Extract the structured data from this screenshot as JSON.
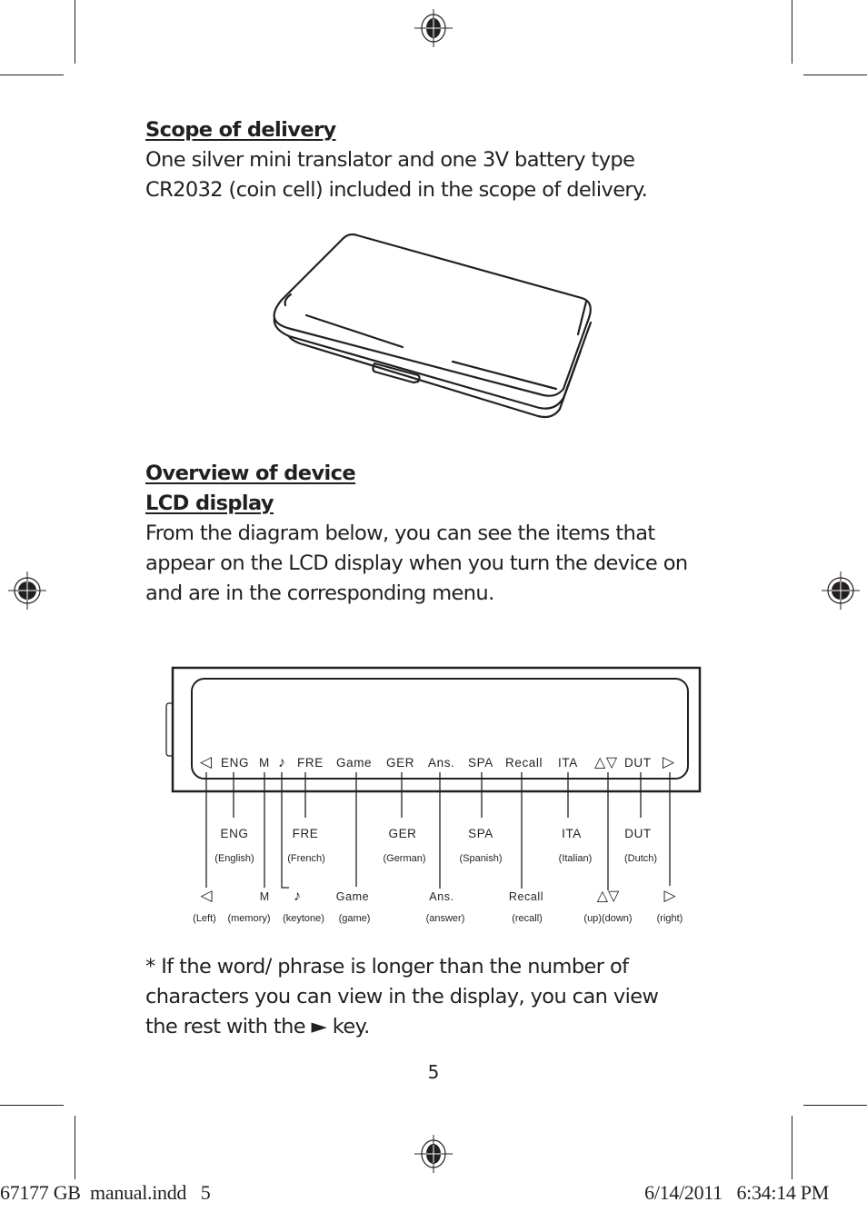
{
  "page": {
    "page_number": "5",
    "slug_left": "67177 GB  manual.indd   5",
    "slug_right": "6/14/2011   6:34:14 PM"
  },
  "scope": {
    "heading": "Scope of delivery",
    "lines": [
      "One silver mini translator and one 3V battery type",
      "CR2032 (coin cell) included in the scope of delivery."
    ]
  },
  "overview": {
    "heading": "Overview of device",
    "subheading": "LCD display",
    "lines": [
      "From the diagram below, you can see the items that",
      "appear on the LCD display when you turn the device on",
      "and are in the corresponding menu."
    ]
  },
  "lcd": {
    "indicators": [
      "◁",
      "ENG",
      "M",
      "♪",
      "FRE",
      "Game",
      "GER",
      "Ans.",
      "SPA",
      "Recall",
      "ITA",
      "△▽",
      "DUT",
      "▷"
    ],
    "upper_labels": [
      {
        "code": "ENG",
        "meaning": "(English)"
      },
      {
        "code": "FRE",
        "meaning": "(French)"
      },
      {
        "code": "GER",
        "meaning": "(German)"
      },
      {
        "code": "SPA",
        "meaning": "(Spanish)"
      },
      {
        "code": "ITA",
        "meaning": "(Italian)"
      },
      {
        "code": "DUT",
        "meaning": "(Dutch)"
      }
    ],
    "lower_labels": [
      {
        "symbol": "◁",
        "meaning": "(Left)"
      },
      {
        "symbol": "M",
        "meaning": "(memory)"
      },
      {
        "symbol": "♪",
        "meaning": "(keytone)"
      },
      {
        "symbol": "Game",
        "meaning": "(game)"
      },
      {
        "symbol": "Ans.",
        "meaning": "(answer)"
      },
      {
        "symbol": "Recall",
        "meaning": "(recall)"
      },
      {
        "symbol": "△▽",
        "meaning": "(up)(down)"
      },
      {
        "symbol": "▷",
        "meaning": "(right)"
      }
    ]
  },
  "note": {
    "lines": [
      "* If the word/ phrase is longer than the number of",
      "characters you can view in the display, you can view",
      "the rest with the ► key."
    ]
  }
}
